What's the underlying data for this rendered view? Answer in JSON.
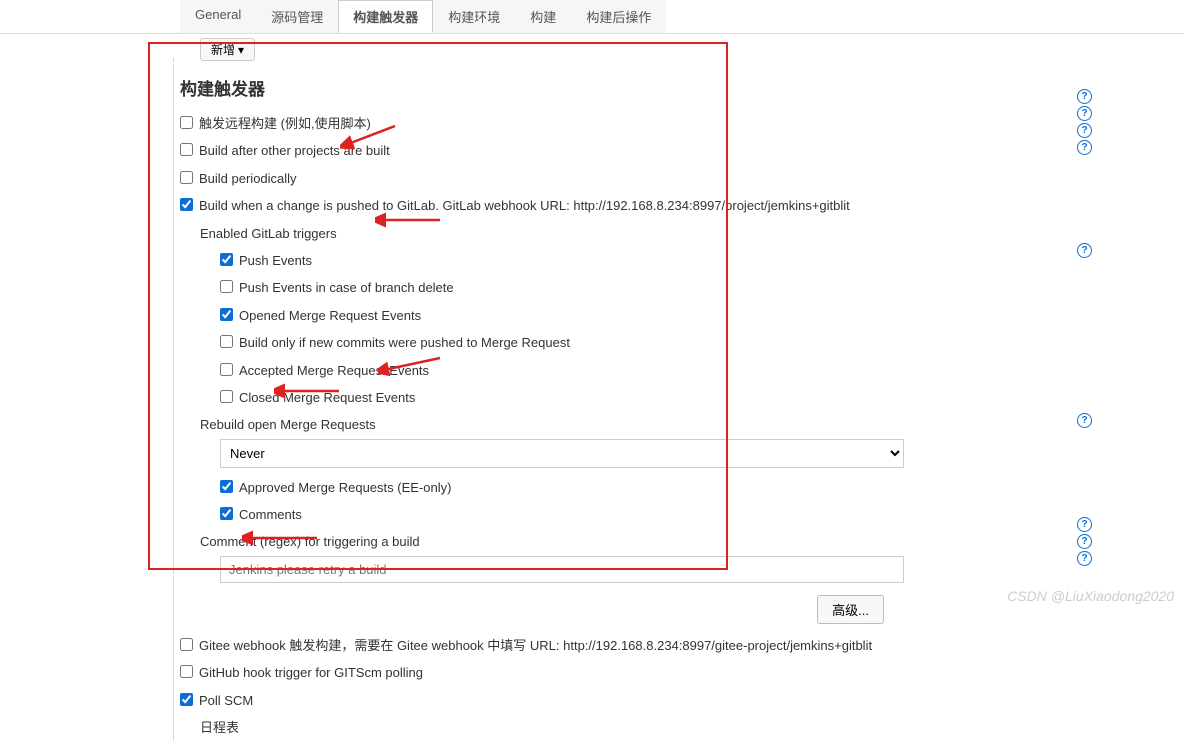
{
  "tabs": {
    "general": "General",
    "source": "源码管理",
    "triggers": "构建触发器",
    "env": "构建环境",
    "build": "构建",
    "post": "构建后操作"
  },
  "addBtn": "新增",
  "sectionTitle": "构建触发器",
  "rows": {
    "remote": "触发远程构建 (例如,使用脚本)",
    "afterOthers": "Build after other projects are built",
    "periodically": "Build periodically",
    "gitlab": "Build when a change is pushed to GitLab. GitLab webhook URL: http://192.168.8.234:8997/project/jemkins+gitblit",
    "enabledTriggers": "Enabled GitLab triggers",
    "pushEvents": "Push Events",
    "pushDelete": "Push Events in case of branch delete",
    "openedMR": "Opened Merge Request Events",
    "buildOnly": "Build only if new commits were pushed to Merge Request",
    "acceptedMR": "Accepted Merge Request Events",
    "closedMR": "Closed Merge Request Events",
    "rebuildLabel": "Rebuild open Merge Requests",
    "rebuildValue": "Never",
    "approvedMR": "Approved Merge Requests (EE-only)",
    "comments": "Comments",
    "commentRegexLabel": "Comment (regex) for triggering a build",
    "commentRegexValue": "Jenkins please retry a build",
    "gitee": "Gitee webhook 触发构建，需要在 Gitee webhook 中填写 URL: http://192.168.8.234:8997/gitee-project/jemkins+gitblit",
    "github": "GitHub hook trigger for GITScm polling",
    "pollSCM": "Poll SCM",
    "schedule": "日程表"
  },
  "advanced": "高级...",
  "watermark": "CSDN @LiuXiaodong2020"
}
